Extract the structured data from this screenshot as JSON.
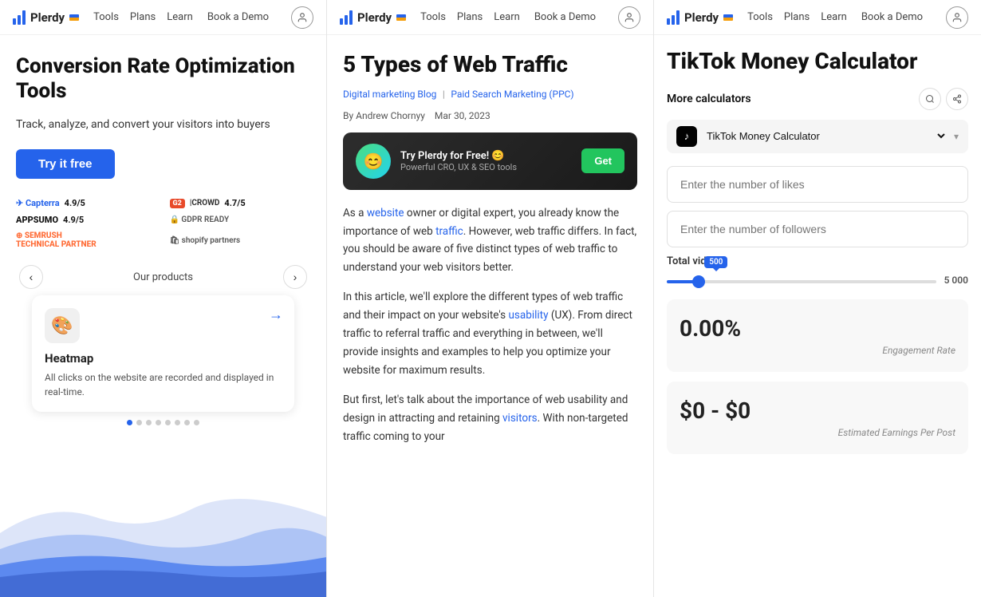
{
  "brand": {
    "name": "Plerdy",
    "flag": "🇺🇦"
  },
  "nav": {
    "tools": "Tools",
    "plans": "Plans",
    "learn": "Learn",
    "book_demo": "Book a Demo"
  },
  "panel1": {
    "hero_title": "Conversion Rate Optimization Tools",
    "hero_sub": "Track, analyze, and convert your visitors into buyers",
    "try_btn": "Try it free",
    "badges": [
      {
        "name": "Capterra",
        "rating": "4.9/5"
      },
      {
        "name": "G2 Crowd",
        "rating": "4.7/5"
      },
      {
        "name": "AppSumo",
        "rating": "4.9/5"
      },
      {
        "name": "GDPR Ready"
      },
      {
        "name": "SemRush Technical Partner"
      },
      {
        "name": "Shopify Partners"
      }
    ],
    "our_products": "Our products",
    "product": {
      "name": "Heatmap",
      "desc": "All clicks on the website are recorded and displayed in real-time.",
      "icon": "🎨"
    },
    "dots": [
      1,
      2,
      3,
      4,
      5,
      6,
      7,
      8
    ],
    "active_dot": 0
  },
  "panel2": {
    "article_title": "5 Types of Web Traffic",
    "category1": "Digital marketing Blog",
    "category2": "Paid Search Marketing (PPC)",
    "author": "By Andrew Chornyy",
    "date": "Mar 30, 2023",
    "promo_title": "Try Plerdy for Free! 😊",
    "promo_sub": "Powerful CRO, UX & SEO tools",
    "promo_get": "Get",
    "paragraphs": [
      "As a website owner or digital expert, you already know the importance of web traffic. However, web traffic differs. In fact, you should be aware of five distinct types of web traffic to understand your web visitors better.",
      "In this article, we'll explore the different types of web traffic and their impact on your website's usability (UX). From direct traffic to referral traffic and everything in between, we'll provide insights and examples to help you optimize your website for maximum results.",
      "But first, let's talk about the importance of web usability and design in attracting and retaining visitors. With non-targeted traffic coming to your"
    ]
  },
  "panel3": {
    "calc_title": "TikTok Money Calculator",
    "more_calculators": "More calculators",
    "selector_value": "TikTok Money Calculator",
    "likes_placeholder": "Enter the number of likes",
    "followers_placeholder": "Enter the number of followers",
    "total_videos_label": "Total videos",
    "slider_value": "500",
    "slider_max": "5 000",
    "engagement_rate": "0.00%",
    "engagement_label": "Engagement Rate",
    "earnings_value": "$0 - $0",
    "earnings_label": "Estimated Earnings Per Post"
  }
}
